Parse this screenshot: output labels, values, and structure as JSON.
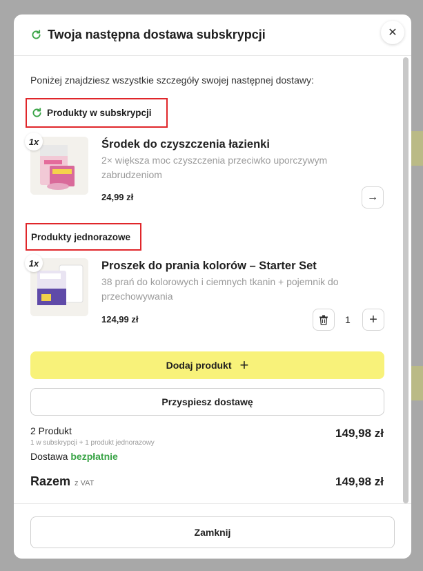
{
  "colors": {
    "accent_green": "#3aa447",
    "highlight_red": "#e0262a",
    "button_yellow": "#f8f27a"
  },
  "header": {
    "title": "Twoja następna dostawa subskrypcji",
    "close_icon": "close-icon",
    "refresh_icon": "refresh-icon"
  },
  "intro": "Poniżej znajdziesz wszystkie szczegóły swojej następnej dostawy:",
  "subscription": {
    "label": "Produkty w subskrypcji",
    "product": {
      "qty": "1x",
      "name": "Środek do czyszczenia łazienki",
      "description": "2× większa moc czyszczenia przeciwko uporczywym zabrudzeniom",
      "price": "24,99 zł",
      "action_icon": "arrow-right-icon"
    }
  },
  "onetime": {
    "label": "Produkty jednorazowe",
    "product": {
      "qty": "1x",
      "name": "Proszek do prania kolorów – Starter Set",
      "description": "38 prań do kolorowych i ciemnych tkanin + pojemnik do przechowywania",
      "price": "124,99 zł",
      "quantity": "1",
      "delete_icon": "trash-icon",
      "add_icon": "plus-icon"
    }
  },
  "actions": {
    "add_product": "Dodaj produkt",
    "speed_up": "Przyspiesz dostawę"
  },
  "summary": {
    "count": "2 Produkt",
    "breakdown": "1 w subskrypcji + 1 produkt jednorazowy",
    "shipping_label": "Dostawa",
    "shipping_value": "bezpłatnie",
    "subtotal": "149,98 zł",
    "total_label": "Razem",
    "total_vat": "z VAT",
    "total": "149,98 zł"
  },
  "footer": {
    "close_label": "Zamknij"
  }
}
